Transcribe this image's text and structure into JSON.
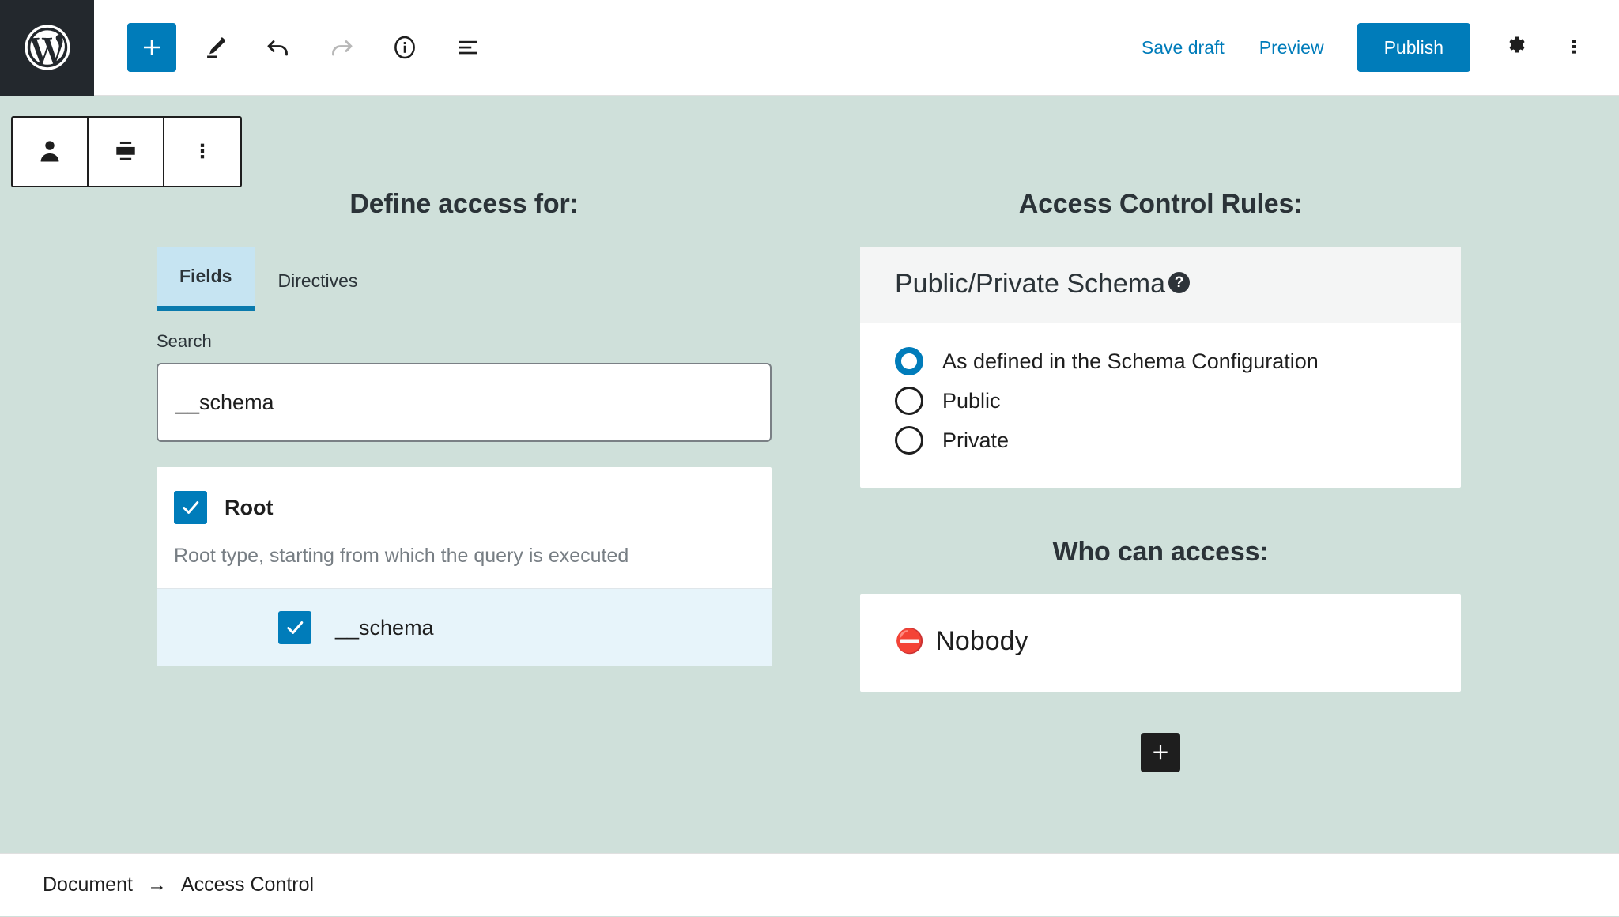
{
  "header": {
    "logo_icon": "wordpress-logo-icon",
    "tools": [
      {
        "name": "add-block-button",
        "icon": "plus-icon",
        "label": "+"
      },
      {
        "name": "edit-tool-button",
        "icon": "pencil-icon",
        "label": ""
      },
      {
        "name": "undo-button",
        "icon": "undo-arrow-icon",
        "label": ""
      },
      {
        "name": "redo-button",
        "icon": "redo-arrow-icon",
        "label": ""
      },
      {
        "name": "details-button",
        "icon": "info-circle-icon",
        "label": ""
      },
      {
        "name": "list-view-button",
        "icon": "list-view-icon",
        "label": ""
      }
    ],
    "save_draft_label": "Save draft",
    "preview_label": "Preview",
    "publish_label": "Publish",
    "settings_icon": "gear-icon",
    "more_options_icon": "more-vertical-icon"
  },
  "block_toolbar": {
    "buttons": [
      {
        "name": "block-type-user-icon",
        "icon": "user-icon"
      },
      {
        "name": "align-center-button",
        "icon": "align-center-icon"
      },
      {
        "name": "block-options-button",
        "icon": "more-vertical-icon"
      }
    ]
  },
  "left_column": {
    "title": "Define access for:",
    "tabs": [
      {
        "label": "Fields",
        "active": true
      },
      {
        "label": "Directives",
        "active": false
      }
    ],
    "search": {
      "label": "Search",
      "value": "__schema",
      "placeholder": "Search"
    },
    "list": {
      "root": {
        "label": "Root",
        "description": "Root type, starting from which the query is executed",
        "checked": true
      },
      "children": [
        {
          "label": "__schema",
          "checked": true,
          "highlighted": true
        }
      ]
    }
  },
  "right_column": {
    "title": "Access Control Rules:",
    "rule_card": {
      "title": "Public/Private Schema",
      "help_icon": "question-mark-icon",
      "help_glyph": "?",
      "options": [
        {
          "label": "As defined in the Schema Configuration",
          "selected": true
        },
        {
          "label": "Public",
          "selected": false
        },
        {
          "label": "Private",
          "selected": false
        }
      ]
    },
    "who_can_access": {
      "title": "Who can access:",
      "entries": [
        {
          "emoji": "⛔",
          "icon_name": "no-entry-icon",
          "label": "Nobody"
        }
      ]
    },
    "add_button": {
      "icon": "plus-icon",
      "label": "+"
    }
  },
  "footer": {
    "breadcrumb": [
      {
        "label": "Document"
      },
      {
        "label": "Access Control"
      }
    ],
    "separator": "→"
  },
  "colors": {
    "canvas_background": "#cfe0da",
    "accent_blue": "#007cba",
    "tab_active_background": "#c6e4f2",
    "child_row_highlight": "#e7f4fa",
    "card_header_background": "#f4f5f5",
    "wp_logo_background": "#23282d"
  }
}
